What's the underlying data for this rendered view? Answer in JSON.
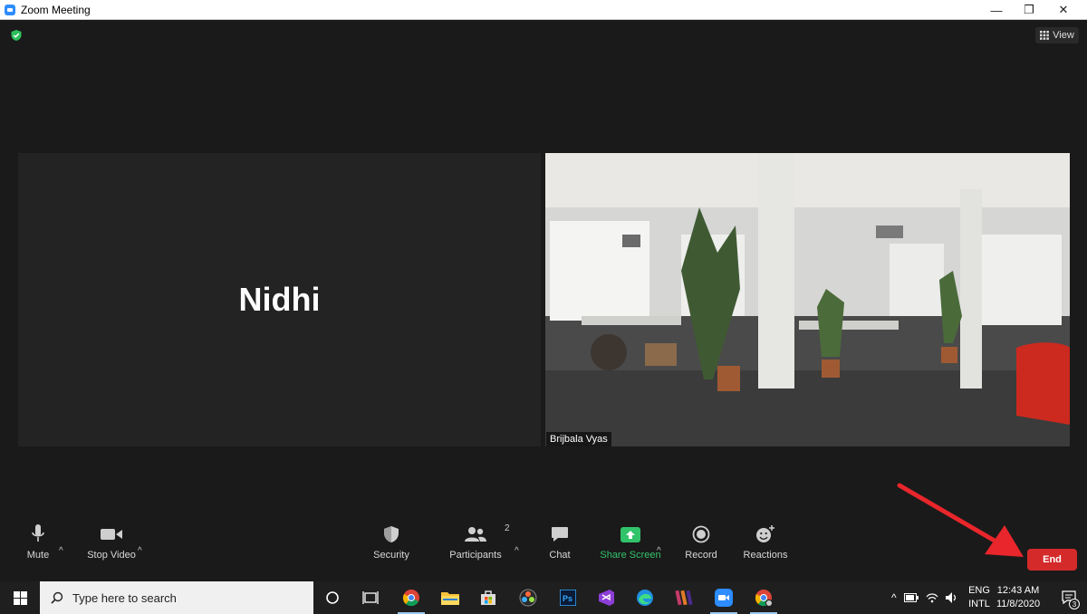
{
  "window": {
    "title": "Zoom Meeting",
    "minimize": "—",
    "restore": "❐",
    "close": "✕"
  },
  "header": {
    "view_label": "View"
  },
  "tiles": {
    "left_name": "Nidhi",
    "right_name": "Brijbala Vyas"
  },
  "toolbar": {
    "mute_label": "Mute",
    "stop_video_label": "Stop Video",
    "security_label": "Security",
    "participants_label": "Participants",
    "participants_count": "2",
    "chat_label": "Chat",
    "share_screen_label": "Share Screen",
    "record_label": "Record",
    "reactions_label": "Reactions",
    "end_label": "End",
    "caret": "^"
  },
  "colors": {
    "share_green": "#31c36a",
    "end_red": "#d42a2a",
    "arrow_red": "#e8262b"
  },
  "taskbar": {
    "search_placeholder": "Type here to search",
    "lang_line1": "ENG",
    "lang_line2": "INTL",
    "time": "12:43 AM",
    "date": "11/8/2020",
    "notification_count": "3",
    "apps": [
      "cortana-icon",
      "task-view-icon",
      "chrome-icon",
      "file-explorer-icon",
      "store-icon",
      "davinci-icon",
      "photoshop-icon",
      "visual-studio-icon",
      "edge-icon",
      "winrar-icon",
      "zoom-icon",
      "chrome-profile-icon"
    ]
  }
}
